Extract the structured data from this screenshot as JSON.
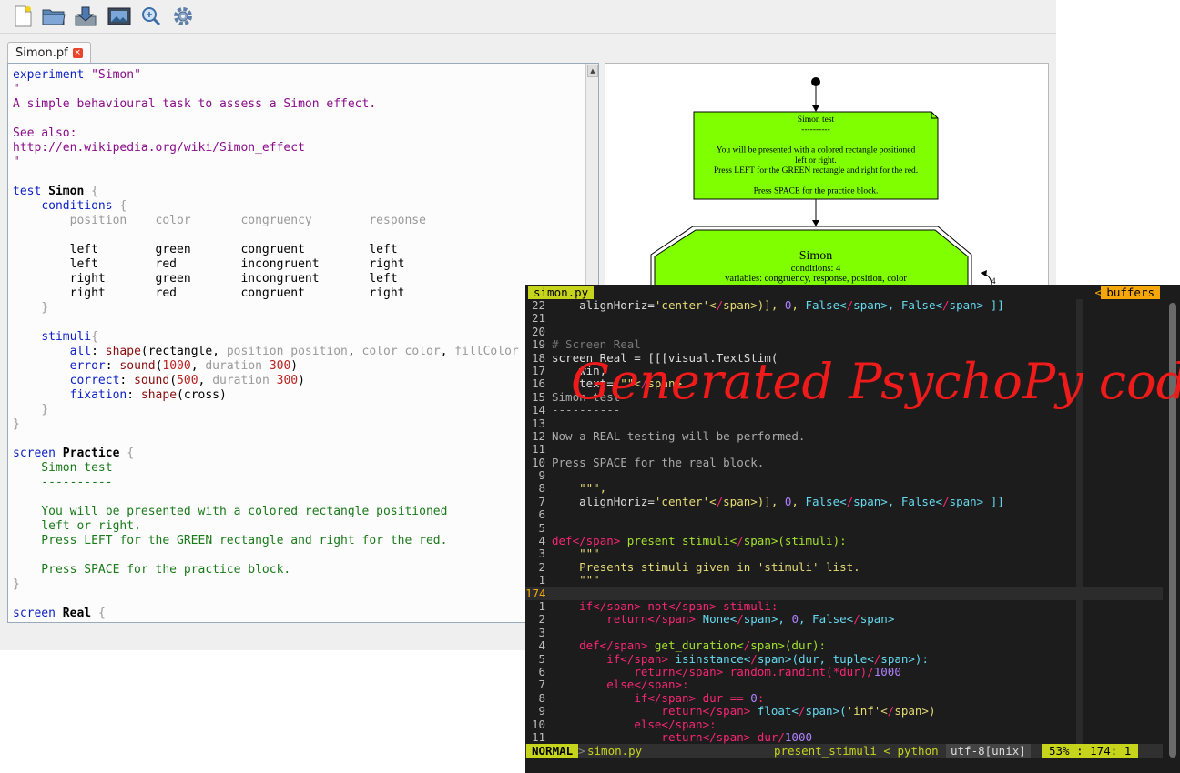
{
  "tab": {
    "label": "Simon.pf"
  },
  "toolbar": {
    "icons": [
      "new-file-icon",
      "open-folder-icon",
      "save-icon",
      "image-icon",
      "zoom-icon",
      "settings-gear-icon"
    ]
  },
  "editor": {
    "lines": [
      "experiment \"Simon\"",
      "\"",
      "A simple behavioural task to assess a Simon effect.",
      "",
      "See also:",
      "http://en.wikipedia.org/wiki/Simon_effect",
      "\"",
      "",
      "test Simon {",
      "    conditions {",
      "        position    color       congruency        response",
      "",
      "        left        green       congruent         left",
      "        left        red         incongruent       right",
      "        right       green       incongruent       left",
      "        right       red         congruent         right",
      "    }",
      "",
      "    stimuli{",
      "        all: shape(rectangle, position position, color color, fillColor",
      "        error: sound(1000, duration 300)",
      "        correct: sound(500, duration 300)",
      "        fixation: shape(cross)",
      "    }",
      "}",
      "",
      "screen Practice {",
      "    Simon test",
      "    ----------",
      "",
      "    You will be presented with a colored rectangle positioned",
      "    left or right.",
      "    Press LEFT for the GREEN rectangle and right for the red.",
      "",
      "    Press SPACE for the practice block.",
      "}",
      "",
      "screen Real {"
    ]
  },
  "diagram": {
    "box1": [
      "Simon test",
      "----------",
      "",
      "You will be presented with a colored rectangle positioned",
      "left or right.",
      "Press LEFT for the GREEN rectangle and right for the red.",
      "",
      "Press SPACE for the practice block."
    ],
    "box2": {
      "title": "Simon",
      "line1": "conditions: 4",
      "line2": "variables: congruency, response, position, color"
    },
    "loop_label": "4"
  },
  "vim": {
    "tab_label": "simon.py",
    "buffers_label": "buffers",
    "buffers_arrow": "<",
    "lines": [
      {
        "n": "22",
        "t": "    alignHoriz='center')], 0, False, False ]]"
      },
      {
        "n": "21",
        "t": ""
      },
      {
        "n": "20",
        "t": ""
      },
      {
        "n": "19",
        "t": "# Screen Real"
      },
      {
        "n": "18",
        "t": "screen_Real = [[[visual.TextStim("
      },
      {
        "n": "17",
        "t": "    win,"
      },
      {
        "n": "16",
        "t": "    text=\"\"\""
      },
      {
        "n": "15",
        "t": "Simon test"
      },
      {
        "n": "14",
        "t": "----------"
      },
      {
        "n": "13",
        "t": ""
      },
      {
        "n": "12",
        "t": "Now a REAL testing will be performed."
      },
      {
        "n": "11",
        "t": ""
      },
      {
        "n": "10",
        "t": "Press SPACE for the real block."
      },
      {
        "n": "9",
        "t": ""
      },
      {
        "n": "8",
        "t": "    \"\"\","
      },
      {
        "n": "7",
        "t": "    alignHoriz='center')], 0, False, False ]]"
      },
      {
        "n": "6",
        "t": ""
      },
      {
        "n": "5",
        "t": ""
      },
      {
        "n": "4",
        "t": "def present_stimuli(stimuli):"
      },
      {
        "n": "3",
        "t": "    \"\"\""
      },
      {
        "n": "2",
        "t": "    Presents stimuli given in 'stimuli' list."
      },
      {
        "n": "1",
        "t": "    \"\"\""
      },
      {
        "n": "174",
        "t": ""
      },
      {
        "n": "1",
        "t": "    if not stimuli:"
      },
      {
        "n": "2",
        "t": "        return None, 0, False"
      },
      {
        "n": "3",
        "t": ""
      },
      {
        "n": "4",
        "t": "    def get_duration(dur):"
      },
      {
        "n": "5",
        "t": "        if isinstance(dur, tuple):"
      },
      {
        "n": "6",
        "t": "            return random.randint(*dur)/1000"
      },
      {
        "n": "7",
        "t": "        else:"
      },
      {
        "n": "8",
        "t": "            if dur == 0:"
      },
      {
        "n": "9",
        "t": "                return float('inf')"
      },
      {
        "n": "10",
        "t": "            else:"
      },
      {
        "n": "11",
        "t": "                return dur/1000"
      }
    ],
    "status": {
      "mode": "NORMAL",
      "file": "simon.py",
      "func": "present_stimuli < python",
      "enc": "utf-8[unix]",
      "pos": "53% : 174:  1"
    }
  },
  "overlay_text": "Generated PsychoPy code"
}
